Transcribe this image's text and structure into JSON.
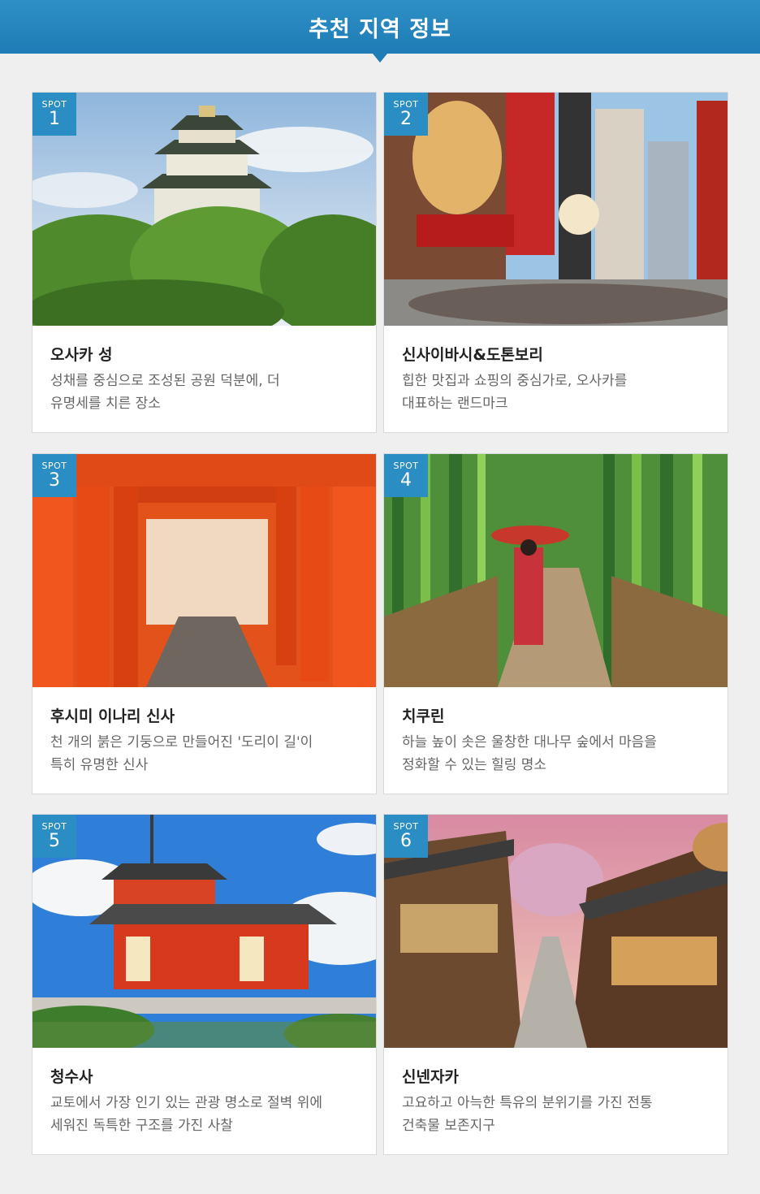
{
  "header": {
    "title": "추천 지역 정보"
  },
  "spot_label": "SPOT",
  "spots": [
    {
      "number": "1",
      "title": "오사카 성",
      "desc_line1": "성채를 중심으로 조성된 공원 덕분에, 더",
      "desc_line2": "유명세를 치른 장소"
    },
    {
      "number": "2",
      "title": "신사이바시&도톤보리",
      "desc_line1": "힙한 맛집과 쇼핑의 중심가로, 오사카를",
      "desc_line2": "대표하는 랜드마크"
    },
    {
      "number": "3",
      "title": "후시미 이나리 신사",
      "desc_line1": "천 개의 붉은 기둥으로 만들어진 '도리이 길'이",
      "desc_line2": "특히 유명한 신사"
    },
    {
      "number": "4",
      "title": "치쿠린",
      "desc_line1": "하늘 높이 솟은 울창한 대나무 숲에서 마음을",
      "desc_line2": "정화할 수 있는 힐링 명소"
    },
    {
      "number": "5",
      "title": "청수사",
      "desc_line1": "교토에서 가장 인기 있는 관광 명소로 절벽 위에",
      "desc_line2": "세워진 독특한 구조를 가진 사찰"
    },
    {
      "number": "6",
      "title": "신넨자카",
      "desc_line1": "고요하고 아늑한 특유의 분위기를 가진 전통",
      "desc_line2": "건축물 보존지구"
    }
  ],
  "colors": {
    "header": "#1f7cb6",
    "badge": "#2a8dc4",
    "background": "#efefef"
  }
}
